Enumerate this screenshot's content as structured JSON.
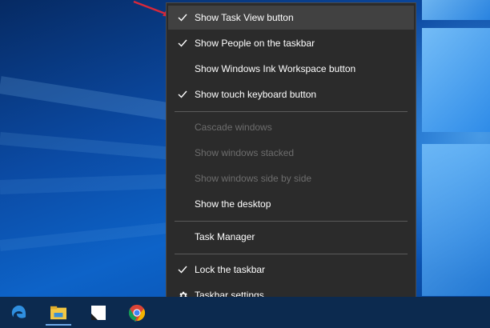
{
  "menu": {
    "items": [
      {
        "label": "Show Task View button",
        "checked": true,
        "enabled": true,
        "hovered": true
      },
      {
        "label": "Show People on the taskbar",
        "checked": true,
        "enabled": true
      },
      {
        "label": "Show Windows Ink Workspace button",
        "checked": false,
        "enabled": true
      },
      {
        "label": "Show touch keyboard button",
        "checked": true,
        "enabled": true
      },
      {
        "label": "Cascade windows",
        "checked": false,
        "enabled": false
      },
      {
        "label": "Show windows stacked",
        "checked": false,
        "enabled": false
      },
      {
        "label": "Show windows side by side",
        "checked": false,
        "enabled": false
      },
      {
        "label": "Show the desktop",
        "checked": false,
        "enabled": true
      },
      {
        "label": "Task Manager",
        "checked": false,
        "enabled": true
      },
      {
        "label": "Lock the taskbar",
        "checked": true,
        "enabled": true
      },
      {
        "label": "Taskbar settings",
        "checked": false,
        "enabled": true,
        "icon": "gear-icon"
      }
    ]
  },
  "taskbar": {
    "pinned": [
      {
        "name": "edge-icon"
      },
      {
        "name": "file-explorer-icon"
      },
      {
        "name": "sticky-notes-icon"
      },
      {
        "name": "chrome-icon"
      }
    ]
  },
  "colors": {
    "menu_bg": "#2b2b2b",
    "menu_hover": "#414141",
    "menu_text": "#ffffff",
    "menu_disabled_text": "#6d6d6d",
    "annotation_arrow": "#d8283a"
  }
}
